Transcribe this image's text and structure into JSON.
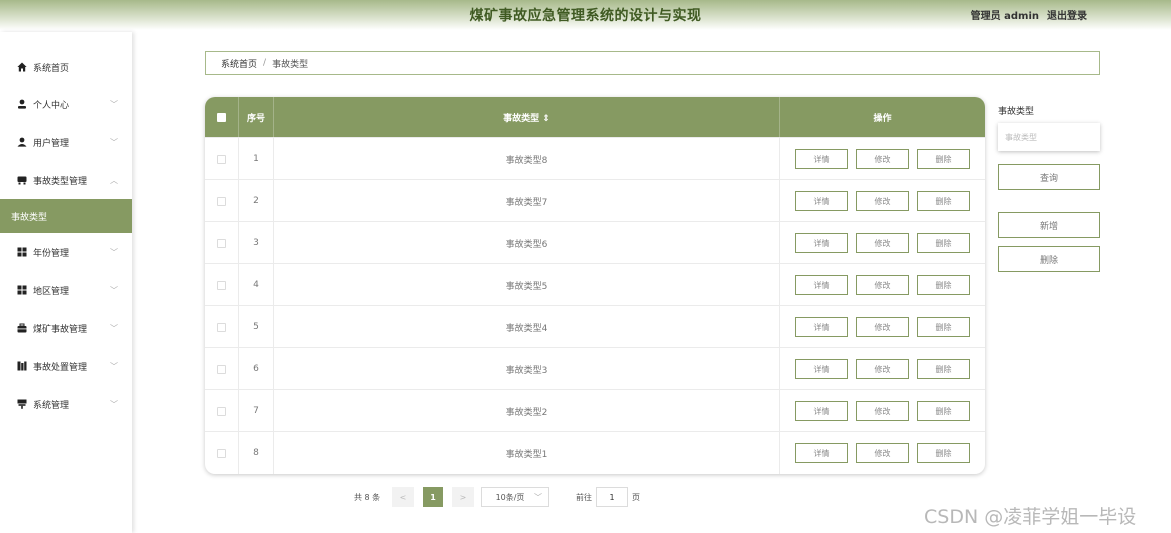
{
  "header": {
    "title": "煤矿事故应急管理系统的设计与实现",
    "user": "管理员 admin",
    "logout": "退出登录"
  },
  "sidebar": {
    "items": [
      {
        "label": "系统首页",
        "icon": "home-icon"
      },
      {
        "label": "个人中心",
        "icon": "person-icon"
      },
      {
        "label": "用户管理",
        "icon": "user-icon"
      },
      {
        "label": "事故类型管理",
        "icon": "tag-icon"
      },
      {
        "label": "事故类型",
        "icon": ""
      },
      {
        "label": "年份管理",
        "icon": "grid-icon"
      },
      {
        "label": "地区管理",
        "icon": "grid-icon"
      },
      {
        "label": "煤矿事故管理",
        "icon": "briefcase-icon"
      },
      {
        "label": "事故处置管理",
        "icon": "book-icon"
      },
      {
        "label": "系统管理",
        "icon": "signpost-icon"
      }
    ]
  },
  "breadcrumb": {
    "home": "系统首页",
    "separator": "/",
    "current": "事故类型"
  },
  "table": {
    "headers": {
      "no": "序号",
      "type": "事故类型 ⇕",
      "op": "操作"
    },
    "rows": [
      {
        "no": "1",
        "type": "事故类型8"
      },
      {
        "no": "2",
        "type": "事故类型7"
      },
      {
        "no": "3",
        "type": "事故类型6"
      },
      {
        "no": "4",
        "type": "事故类型5"
      },
      {
        "no": "5",
        "type": "事故类型4"
      },
      {
        "no": "6",
        "type": "事故类型3"
      },
      {
        "no": "7",
        "type": "事故类型2"
      },
      {
        "no": "8",
        "type": "事故类型1"
      }
    ],
    "actions": {
      "detail": "详情",
      "edit": "修改",
      "delete": "删除"
    }
  },
  "search": {
    "label": "事故类型",
    "placeholder": "事故类型",
    "query": "查询",
    "add": "新增",
    "delete": "删除"
  },
  "pagination": {
    "total": "共 8 条",
    "prev": "<",
    "current": "1",
    "next": ">",
    "page_size": "10条/页",
    "goto_prefix": "前往",
    "goto_value": "1",
    "goto_suffix": "页"
  },
  "watermark": "CSDN @凌菲学姐一毕设",
  "colors": {
    "accent": "#869a62",
    "header_top": "#a7b98a",
    "title": "#3f5a22"
  }
}
